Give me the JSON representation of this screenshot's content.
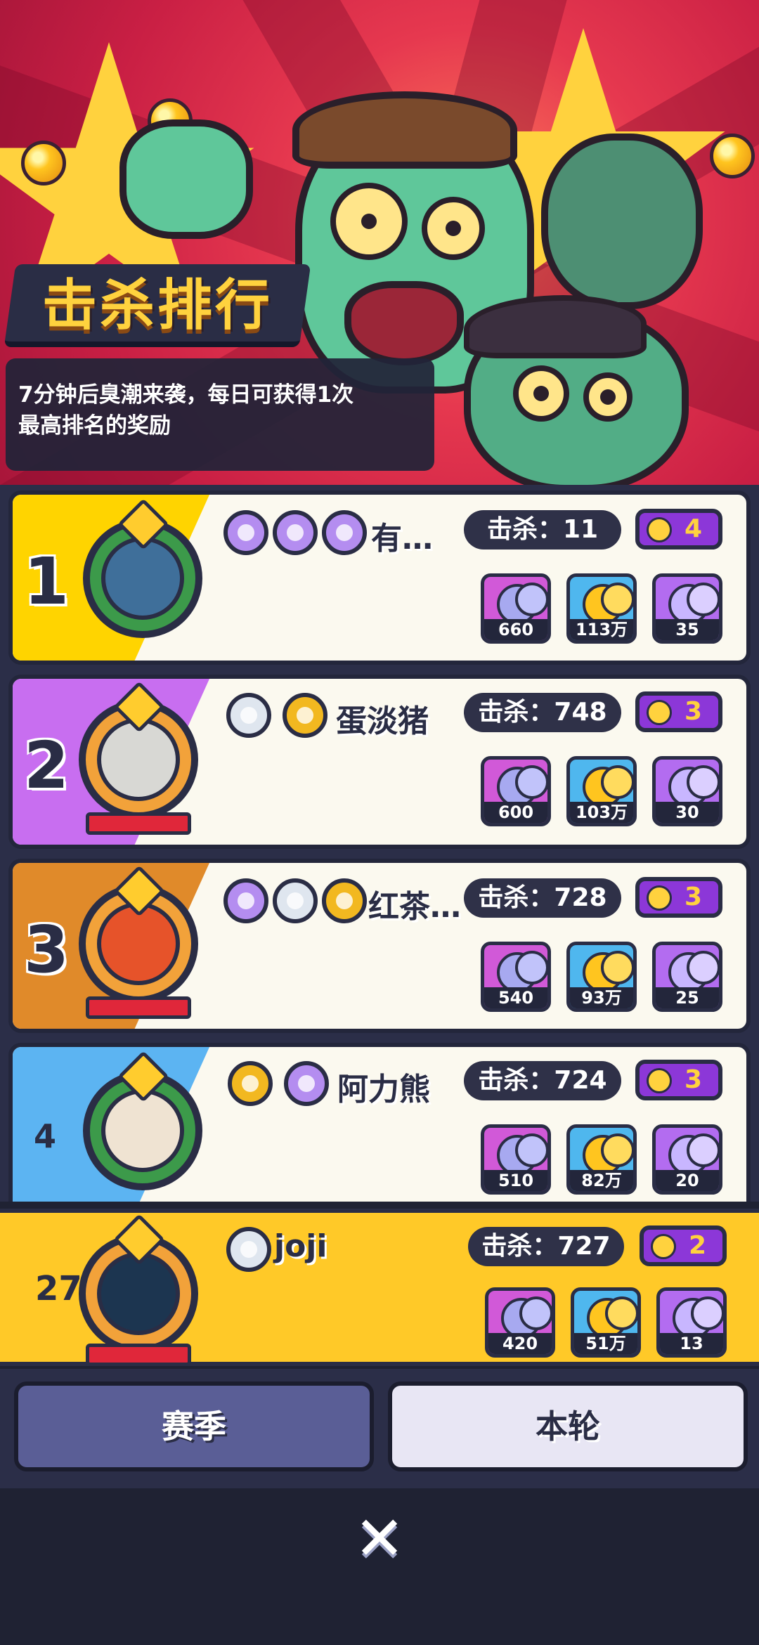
{
  "header": {
    "title": "击杀排行",
    "description_lines": [
      "7分钟后臭潮来袭，每日可获得1次",
      "最高排名的奖励"
    ]
  },
  "colors": {
    "rank1": "#ffd400",
    "rank2": "#c86ef0",
    "rank3": "#e08a2a",
    "rank4": "#5cb4f2",
    "my_row": "#ffc928",
    "score_purple": "#8c37d8",
    "dark": "#2a2d45"
  },
  "leaderboard": [
    {
      "rank": "1",
      "name": "有…",
      "kills": "击杀：11",
      "score": "4",
      "rewards": [
        "660",
        "113万",
        "35"
      ]
    },
    {
      "rank": "2",
      "name": "蛋淡猪",
      "kills": "击杀：748",
      "score": "3",
      "rewards": [
        "600",
        "103万",
        "30"
      ]
    },
    {
      "rank": "3",
      "name": "红茶…",
      "kills": "击杀：728",
      "score": "3",
      "rewards": [
        "540",
        "93万",
        "25"
      ]
    },
    {
      "rank": "4",
      "name": "阿力熊",
      "kills": "击杀：724",
      "score": "3",
      "rewards": [
        "510",
        "82万",
        "20"
      ]
    }
  ],
  "me": {
    "rank": "27",
    "name": "joji",
    "kills": "击杀：727",
    "score": "2",
    "rewards": [
      "420",
      "51万",
      "13"
    ]
  },
  "tabs": {
    "season": "赛季",
    "round": "本轮"
  },
  "close_icon": "✕"
}
